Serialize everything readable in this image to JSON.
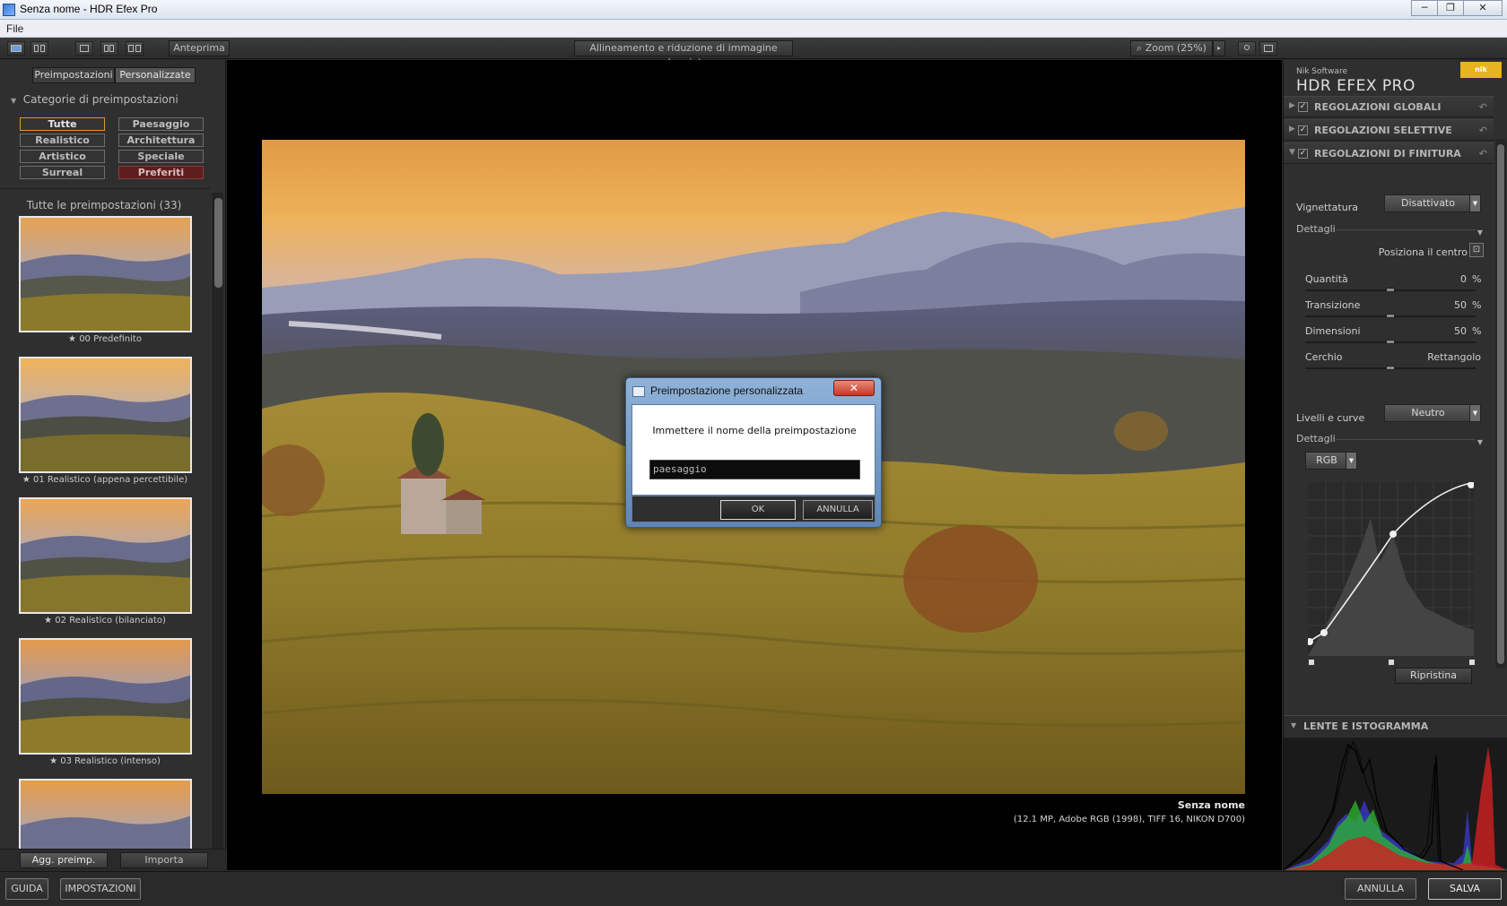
{
  "window": {
    "title": "Senza nome - HDR Efex Pro"
  },
  "menu": {
    "file": "File"
  },
  "toolbar": {
    "preview_label": "Anteprima",
    "center_label": "Allineamento e riduzione di immagine sdoppiata",
    "zoom_label": "Zoom (25%)"
  },
  "left": {
    "tabs": [
      "Preimpostazioni",
      "Personalizzate"
    ],
    "section_title": "Categorie di preimpostazioni",
    "categories": [
      "Tutte",
      "Paesaggio",
      "Realistico",
      "Architettura",
      "Artistico",
      "Speciale",
      "Surreal",
      "Preferiti"
    ],
    "presets_title": "Tutte le preimpostazioni (33)",
    "presets": [
      "00 Predefinito",
      "01 Realistico (appena percettibile)",
      "02 Realistico (bilanciato)",
      "03 Realistico (intenso)"
    ],
    "add_preset": "Agg. preimp.",
    "import": "Importa"
  },
  "image": {
    "name": "Senza nome",
    "info": "(12.1 MP, Adobe RGB (1998), TIFF 16, NIKON D700)"
  },
  "right": {
    "brand_small": "Nik Software",
    "brand_big": "HDR EFEX PRO",
    "sections": [
      "REGOLAZIONI GLOBALI",
      "REGOLAZIONI SELETTIVE",
      "REGOLAZIONI DI FINITURA"
    ],
    "vignette_label": "Vignettatura",
    "vignette_value": "Disattivato",
    "details": "Dettagli",
    "position_center": "Posiziona il centro",
    "sliders": [
      {
        "label": "Quantità",
        "value": "0",
        "unit": "%",
        "level": 0.5
      },
      {
        "label": "Transizione",
        "value": "50",
        "unit": "%",
        "level": 0.5
      },
      {
        "label": "Dimensioni",
        "value": "50",
        "unit": "%",
        "level": 0.5
      },
      {
        "label": "Cerchio",
        "value": "Rettangolo",
        "unit": "",
        "level": 0.5
      }
    ],
    "levels_label": "Livelli e curve",
    "levels_value": "Neutro",
    "details2": "Dettagli",
    "channel": "RGB",
    "reset": "Ripristina",
    "loupe_title": "LENTE E ISTOGRAMMA"
  },
  "bottom": {
    "guide": "GUIDA",
    "settings": "IMPOSTAZIONI",
    "cancel": "ANNULLA",
    "save": "SALVA"
  },
  "dialog": {
    "title": "Preimpostazione personalizzata",
    "message": "Immettere il nome della preimpostazione",
    "input_value": "paesaggio",
    "ok": "OK",
    "cancel": "ANNULLA"
  }
}
